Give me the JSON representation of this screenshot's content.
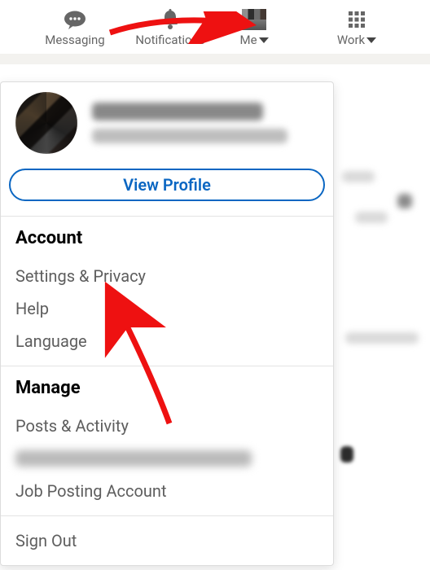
{
  "nav": {
    "messaging": "Messaging",
    "notifications": "Notifications",
    "me": "Me",
    "work": "Work"
  },
  "dropdown": {
    "view_profile": "View Profile",
    "account_heading": "Account",
    "settings_privacy": "Settings & Privacy",
    "help": "Help",
    "language": "Language",
    "manage_heading": "Manage",
    "posts_activity": "Posts & Activity",
    "job_posting_account": "Job Posting Account",
    "sign_out": "Sign Out"
  },
  "colors": {
    "link_blue": "#0a66c2"
  }
}
